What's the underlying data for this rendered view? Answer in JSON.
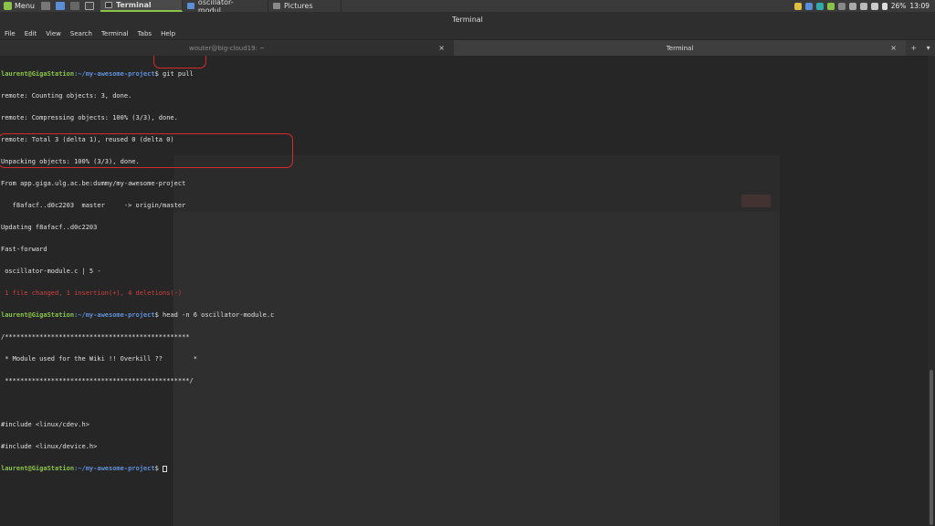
{
  "panel": {
    "menu_label": "Menu",
    "tasks": [
      {
        "label": "Terminal",
        "active": true
      },
      {
        "label": "oscillator-modul...",
        "active": false
      },
      {
        "label": "Pictures",
        "active": false
      }
    ],
    "battery": "26%",
    "time": "13:09"
  },
  "window": {
    "title": "Terminal"
  },
  "menubar": {
    "items": [
      "File",
      "Edit",
      "View",
      "Search",
      "Terminal",
      "Tabs",
      "Help"
    ]
  },
  "tabs": [
    {
      "label": "wouter@big-cloud19: ~"
    },
    {
      "label": "Terminal"
    }
  ],
  "tab_close": "×",
  "tab_extras": [
    "+",
    "▾"
  ],
  "terminal": {
    "user": "laurent@GigaStation",
    "path": ":~/my-awesome-project",
    "dollar": "$",
    "cmd1": " git pull",
    "out1": [
      "remote: Counting objects: 3, done.",
      "remote: Compressing objects: 100% (3/3), done.",
      "remote: Total 3 (delta 1), reused 0 (delta 0)",
      "Unpacking objects: 100% (3/3), done.",
      "From app.giga.ulg.ac.be:dummy/my-awesome-project",
      "   f8afacf..d0c2203  master     -> origin/master",
      "Updating f8afacf..d0c2203",
      "Fast-forward",
      " oscillator-module.c | 5 -",
      " 1 file changed, 1 insertion(+), 4 deletions(-)"
    ],
    "cmd2": " head -n 6 oscillator-module.c",
    "out2": [
      "/************************************************",
      " * Module used for the Wiki !! Overkill ??        *",
      " ************************************************/",
      "",
      "#include <linux/cdev.h>",
      "#include <linux/device.h>"
    ]
  }
}
